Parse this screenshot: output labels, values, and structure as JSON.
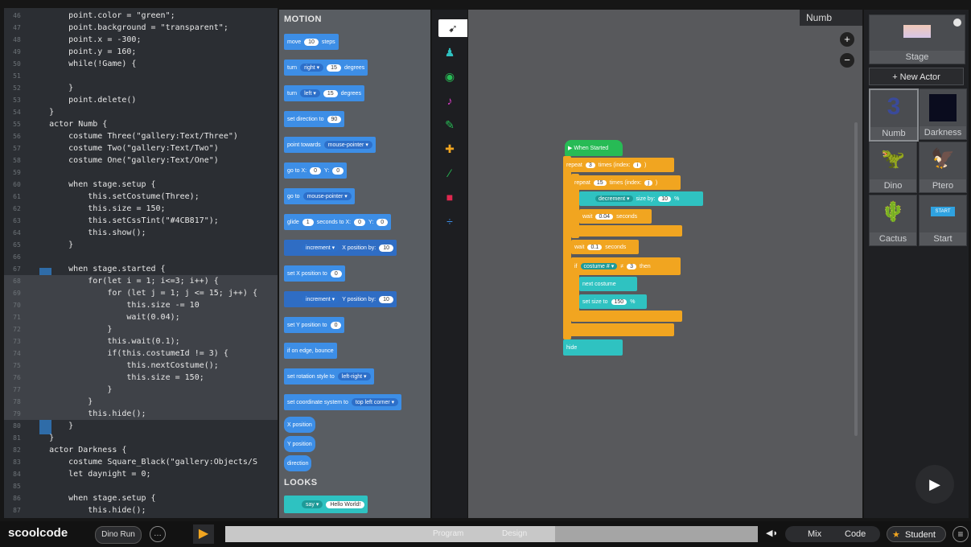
{
  "code": {
    "lines": [
      {
        "n": "46",
        "t": "        point.color = \"green\";"
      },
      {
        "n": "47",
        "t": "        point.background = \"transparent\";"
      },
      {
        "n": "48",
        "t": "        point.x = -300;"
      },
      {
        "n": "49",
        "t": "        point.y = 160;"
      },
      {
        "n": "50",
        "t": "        while(!Game) {"
      },
      {
        "n": "51",
        "t": ""
      },
      {
        "n": "52",
        "t": "        }"
      },
      {
        "n": "53",
        "t": "        point.delete()"
      },
      {
        "n": "54",
        "t": "    }"
      },
      {
        "n": "55",
        "t": "    actor Numb {"
      },
      {
        "n": "56",
        "t": "        costume Three(\"gallery:Text/Three\")"
      },
      {
        "n": "57",
        "t": "        costume Two(\"gallery:Text/Two\")"
      },
      {
        "n": "58",
        "t": "        costume One(\"gallery:Text/One\")"
      },
      {
        "n": "59",
        "t": ""
      },
      {
        "n": "60",
        "t": "        when stage.setup {"
      },
      {
        "n": "61",
        "t": "            this.setCostume(Three);"
      },
      {
        "n": "62",
        "t": "            this.size = 150;"
      },
      {
        "n": "63",
        "t": "            this.setCssTint(\"#4CB817\");"
      },
      {
        "n": "64",
        "t": "            this.show();"
      },
      {
        "n": "65",
        "t": "        }"
      },
      {
        "n": "66",
        "t": ""
      },
      {
        "n": "67",
        "t": "        when stage.started {"
      },
      {
        "n": "68",
        "t": "            for(let i = 1; i<=3; i++) {"
      },
      {
        "n": "69",
        "t": "                for (let j = 1; j <= 15; j++) {"
      },
      {
        "n": "70",
        "t": "                    this.size -= 10"
      },
      {
        "n": "71",
        "t": "                    wait(0.04);"
      },
      {
        "n": "72",
        "t": "                }"
      },
      {
        "n": "73",
        "t": "                this.wait(0.1);"
      },
      {
        "n": "74",
        "t": "                if(this.costumeId != 3) {"
      },
      {
        "n": "75",
        "t": "                    this.nextCostume();"
      },
      {
        "n": "76",
        "t": "                    this.size = 150;"
      },
      {
        "n": "77",
        "t": "                }"
      },
      {
        "n": "78",
        "t": "            }"
      },
      {
        "n": "79",
        "t": "            this.hide();"
      },
      {
        "n": "80",
        "t": "        }"
      },
      {
        "n": "81",
        "t": "    }"
      },
      {
        "n": "82",
        "t": "    actor Darkness {"
      },
      {
        "n": "83",
        "t": "        costume Square_Black(\"gallery:Objects/S"
      },
      {
        "n": "84",
        "t": "        let daynight = 0;"
      },
      {
        "n": "85",
        "t": ""
      },
      {
        "n": "86",
        "t": "        when stage.setup {"
      },
      {
        "n": "87",
        "t": "            this.hide();"
      }
    ]
  },
  "palette": {
    "motion_header": "MOTION",
    "looks_header": "LOOKS",
    "blocks": {
      "move": {
        "a": "move",
        "v": "10",
        "b": "steps"
      },
      "turn_right": {
        "a": "turn",
        "d": "right ▾",
        "v": "15",
        "b": "degrees"
      },
      "turn_left": {
        "a": "turn",
        "d": "left ▾",
        "v": "15",
        "b": "degrees"
      },
      "set_direction": {
        "a": "set direction to",
        "v": "90"
      },
      "point_towards": {
        "a": "point towards",
        "d": "mouse-pointer ▾"
      },
      "goto_xy": {
        "a": "go to X:",
        "v": "0",
        "b": "Y:",
        "v2": "0"
      },
      "goto": {
        "a": "go to",
        "d": "mouse-pointer ▾"
      },
      "glide": {
        "a": "glide",
        "v": "1",
        "b": "seconds to X:",
        "v2": "0",
        "c": "Y:",
        "v3": "0"
      },
      "change_x": {
        "d": "increment ▾",
        "a": "X position by:",
        "v": "10"
      },
      "set_x": {
        "a": "set X position to",
        "v": "0"
      },
      "change_y": {
        "d": "increment ▾",
        "a": "Y position by:",
        "v": "10"
      },
      "set_y": {
        "a": "set Y position to",
        "v": "0"
      },
      "bounce": {
        "a": "if on edge, bounce"
      },
      "rotation": {
        "a": "set rotation style to",
        "d": "left-right ▾"
      },
      "coord": {
        "a": "set coordinate system to",
        "d": "top left corner ▾"
      },
      "xpos": {
        "a": "X position"
      },
      "ypos": {
        "a": "Y position"
      },
      "direction": {
        "a": "direction"
      },
      "say": {
        "d": "say ▾",
        "v": "Hello World!"
      }
    }
  },
  "stage": {
    "label": "Numb",
    "zoom_in": "+",
    "zoom_out": "−",
    "script": {
      "hat": "▶ When Started",
      "repeat1": {
        "a": "repeat",
        "v": "3",
        "b": "times (index:",
        "v2": "i",
        "c": ")"
      },
      "repeat2": {
        "a": "repeat",
        "v": "15",
        "b": "times (index:",
        "v2": "j",
        "c": ")"
      },
      "change_size": {
        "d": "decrement ▾",
        "a": "size by:",
        "v": "10",
        "b": "%"
      },
      "wait1": {
        "a": "wait",
        "v": "0.04",
        "b": "seconds"
      },
      "wait2": {
        "a": "wait",
        "v": "0.1",
        "b": "seconds"
      },
      "if": {
        "a": "if",
        "d": "costume # ▾",
        "op": "≠",
        "v": "3",
        "b": "then"
      },
      "next_costume": {
        "a": "next costume"
      },
      "set_size": {
        "a": "set size to",
        "v": "150",
        "b": "%"
      },
      "hide": {
        "a": "hide"
      }
    }
  },
  "sprites": {
    "stage_label": "Stage",
    "new_actor": "+ New Actor",
    "items": [
      {
        "label": "Numb",
        "thumb": "3"
      },
      {
        "label": "Darkness",
        "thumb": ""
      },
      {
        "label": "Dino",
        "thumb": "🦖"
      },
      {
        "label": "Ptero",
        "thumb": "🦅"
      },
      {
        "label": "Cactus",
        "thumb": "🌵"
      },
      {
        "label": "Start",
        "thumb": "START"
      }
    ]
  },
  "bottom": {
    "logo": "scoolcode",
    "project": "Dino Run",
    "more": "…",
    "play": "▶",
    "tab1": "Program",
    "tab2": "Design",
    "mix": "Mix",
    "code": "Code",
    "student": "Student",
    "menu": "≡"
  },
  "colors": {
    "motion": "#3d8ee6",
    "control": "#f1a520",
    "event": "#27bb55",
    "looks": "#2fc2c1"
  }
}
